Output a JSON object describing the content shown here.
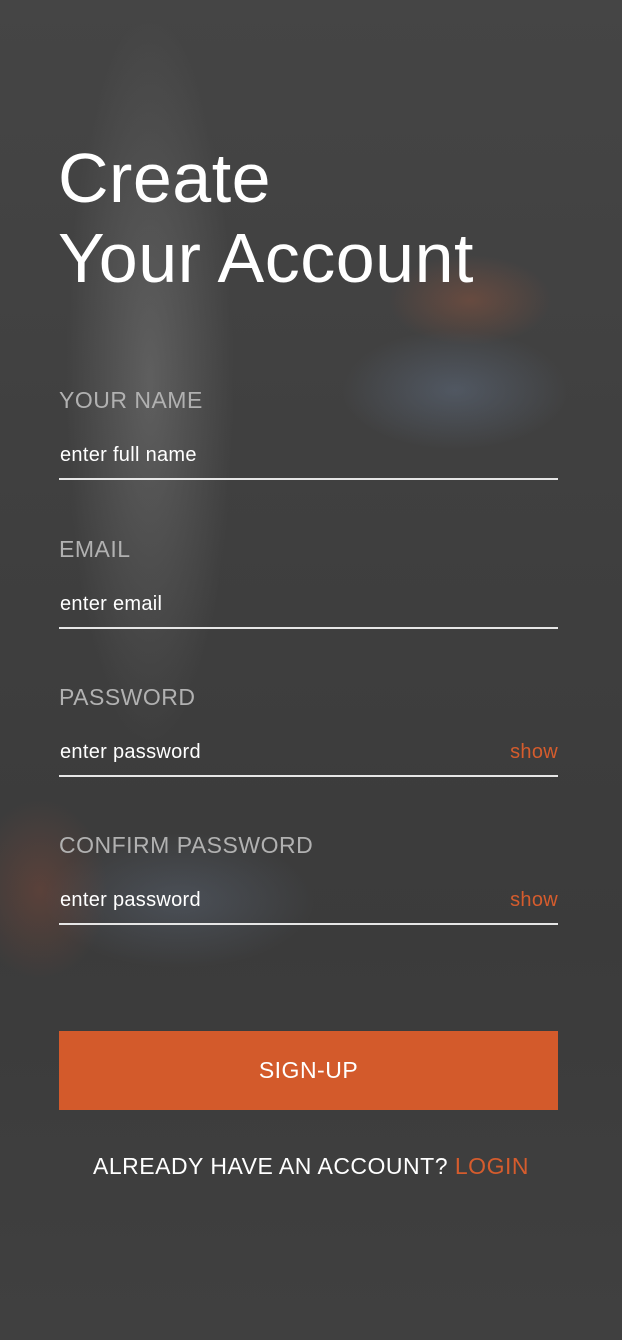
{
  "header": {
    "title_line1": "Create",
    "title_line2": "Your Account"
  },
  "form": {
    "name": {
      "label": "YOUR NAME",
      "placeholder": "enter full name"
    },
    "email": {
      "label": "EMAIL",
      "placeholder": "enter email"
    },
    "password": {
      "label": "PASSWORD",
      "placeholder": "enter password",
      "toggle": "show"
    },
    "confirm_password": {
      "label": "CONFIRM PASSWORD",
      "placeholder": "enter password",
      "toggle": "show"
    }
  },
  "actions": {
    "signup_label": "SIGN-UP",
    "login_prompt": "ALREADY HAVE AN ACCOUNT?",
    "login_label": "LOGIN"
  },
  "colors": {
    "accent": "#d35a2b",
    "text_primary": "#ffffff",
    "label_muted": "#b1b1b1",
    "background": "#3f3f3f"
  }
}
